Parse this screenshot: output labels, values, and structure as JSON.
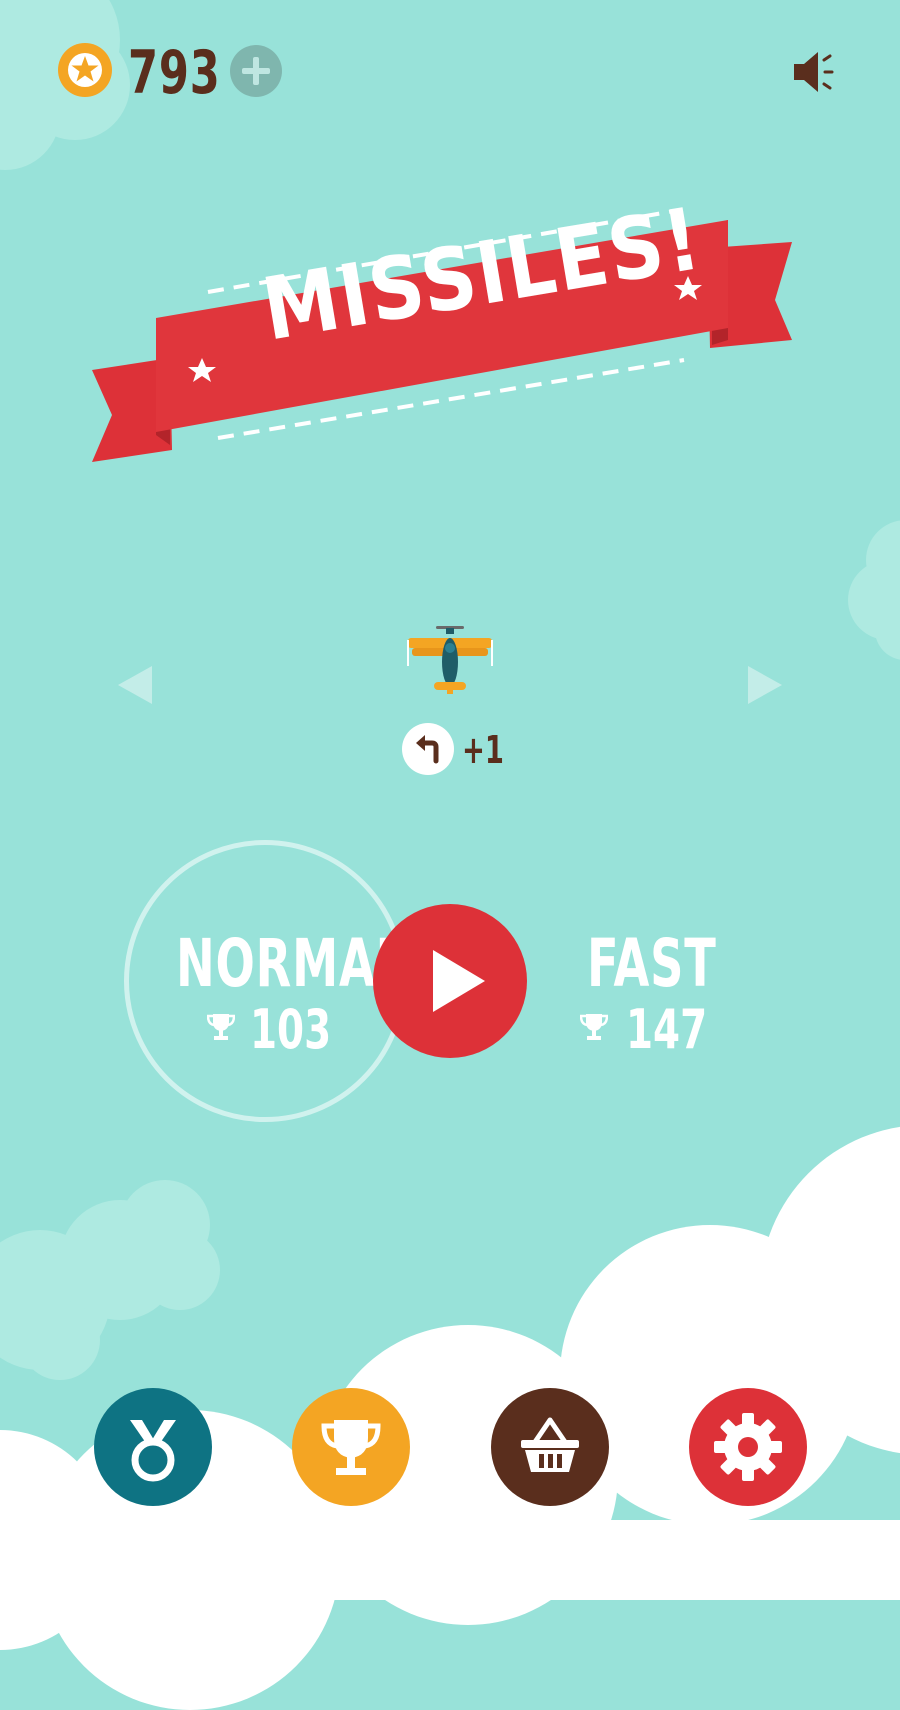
{
  "game": {
    "title": "MISSILES!"
  },
  "top_bar": {
    "coins": "793",
    "coin_icon": "star-coin-icon",
    "add_coins_icon": "plus-icon",
    "sound_icon": "speaker-icon"
  },
  "plane_select": {
    "prev_icon": "triangle-left-icon",
    "next_icon": "triangle-right-icon",
    "revive_bonus": "+1",
    "revive_icon": "turn-back-arrow-icon"
  },
  "modes": {
    "normal": {
      "label": "NORMAL",
      "best": "103"
    },
    "fast": {
      "label": "FAST",
      "best": "147"
    },
    "selected": "normal"
  },
  "menu": [
    {
      "name": "achievements",
      "icon": "medal-icon",
      "color": "#0e7383"
    },
    {
      "name": "leaderboard",
      "icon": "trophy-icon",
      "color": "#f4a523"
    },
    {
      "name": "shop",
      "icon": "basket-icon",
      "color": "#5a2e1d"
    },
    {
      "name": "settings",
      "icon": "gear-icon",
      "color": "#dd3138"
    }
  ],
  "colors": {
    "sky": "#98e2d9",
    "accent_red": "#dd3138",
    "text_brown": "#5a2e1d",
    "coin_orange": "#f4a523",
    "teal": "#0e7383"
  }
}
